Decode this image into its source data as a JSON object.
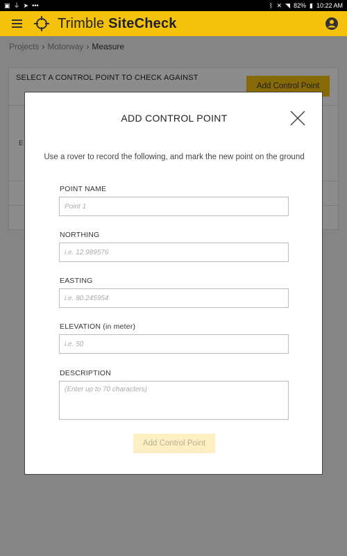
{
  "status_bar": {
    "battery": "82%",
    "time": "10:22 AM",
    "more": "•••"
  },
  "app_bar": {
    "title_regular": "Trimble ",
    "title_bold": "SiteCheck"
  },
  "breadcrumb": {
    "items": [
      "Projects",
      "Motorway",
      "Measure"
    ]
  },
  "background_card": {
    "select_label": "SELECT A CONTROL POINT TO CHECK AGAINST",
    "add_button_label": "Add Control Point",
    "stub_letter": "E"
  },
  "modal": {
    "title": "ADD CONTROL POINT",
    "subtitle": "Use a rover to record the following, and mark the new point on the ground",
    "fields": {
      "point_name": {
        "label": "POINT NAME",
        "placeholder": "Point 1"
      },
      "northing": {
        "label": "NORTHING",
        "placeholder": "i.e. 12.989576"
      },
      "easting": {
        "label": "EASTING",
        "placeholder": "i.e. 80.245954"
      },
      "elevation": {
        "label": "ELEVATION (in meter)",
        "placeholder": "i.e. 50"
      },
      "description": {
        "label": "DESCRIPTION",
        "placeholder": "(Enter up to 70 characters)"
      }
    },
    "submit_label": "Add Control Point"
  },
  "colors": {
    "accent": "#f4c20d",
    "submit_disabled_bg": "#fcefc1",
    "submit_disabled_text": "#b9b195"
  }
}
